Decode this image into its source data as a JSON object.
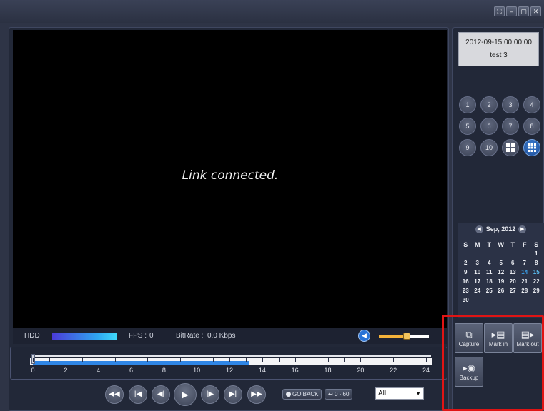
{
  "window": {
    "buttons": [
      "⛶",
      "–",
      "▢",
      "✕"
    ]
  },
  "video": {
    "message": "Link connected."
  },
  "status": {
    "hdd_label": "HDD",
    "fps_label": "FPS :",
    "fps_value": "0",
    "bitrate_label": "BitRate :",
    "bitrate_value": "0.0 Kbps",
    "volume_level": 0.55
  },
  "timeline": {
    "hours": [
      "0",
      "2",
      "4",
      "6",
      "8",
      "10",
      "12",
      "14",
      "16",
      "18",
      "20",
      "22",
      "24"
    ],
    "recorded_until_hour": 13.2
  },
  "playback": {
    "go_back_label": "GO BACK",
    "range_label": "0 - 60",
    "filter_selected": "All"
  },
  "info": {
    "datetime": "2012-09-15 00:00:00",
    "camera_name": "test 3"
  },
  "channels": [
    "1",
    "2",
    "3",
    "4",
    "5",
    "6",
    "7",
    "8",
    "9",
    "10"
  ],
  "calendar": {
    "month_label": "Sep, 2012",
    "weekdays": [
      "S",
      "M",
      "T",
      "W",
      "T",
      "F",
      "S"
    ],
    "days": [
      "",
      "",
      "",
      "",
      "",
      "",
      "1",
      "2",
      "3",
      "4",
      "5",
      "6",
      "7",
      "8",
      "9",
      "10",
      "11",
      "12",
      "13",
      "14",
      "15",
      "16",
      "17",
      "18",
      "19",
      "20",
      "21",
      "22",
      "23",
      "24",
      "25",
      "26",
      "27",
      "28",
      "29",
      "30"
    ],
    "highlighted_day": "14",
    "selected_day": "15"
  },
  "actions": {
    "capture": "Capture",
    "mark_in": "Mark in",
    "mark_out": "Mark out",
    "backup": "Backup"
  }
}
